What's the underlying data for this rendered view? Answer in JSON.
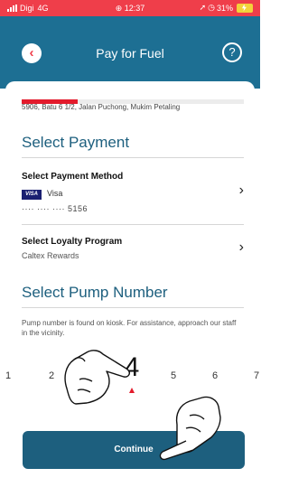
{
  "status_bar": {
    "carrier": "Digi",
    "network": "4G",
    "time": "12:37",
    "battery": "31%"
  },
  "header": {
    "back_icon": "chevron-left-icon",
    "title": "Pay for Fuel",
    "help_label": "?"
  },
  "progress": {
    "fraction": 0.25,
    "color": "#e31b2c"
  },
  "location": {
    "address": "5906, Batu 6 1/2, Jalan Puchong, Mukim Petaling"
  },
  "payment": {
    "section_title": "Select Payment",
    "method_label": "Select Payment Method",
    "card_brand_badge": "VISA",
    "card_brand": "Visa",
    "card_number": "···· ···· ···· 5156",
    "loyalty_label": "Select Loyalty Program",
    "loyalty_value": "Caltex Rewards",
    "chevron_icon": "chevron-right-icon"
  },
  "pump": {
    "section_title": "Select Pump Number",
    "help_text": "Pump number is found on kiosk. For assistance, approach our staff in the vicinity.",
    "numbers": [
      "1",
      "2",
      "4",
      "5",
      "6",
      "7"
    ],
    "selected": "4"
  },
  "actions": {
    "continue_label": "Continue"
  },
  "colors": {
    "status_bar": "#ef3e4a",
    "header": "#1d6f93",
    "primary": "#1d5f7e",
    "accent_red": "#e31b2c"
  }
}
